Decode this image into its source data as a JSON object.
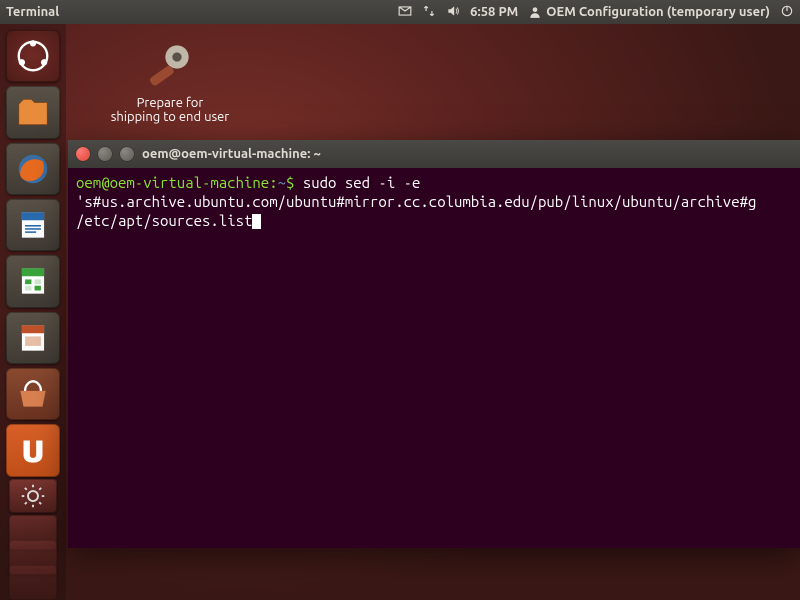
{
  "topbar": {
    "app_title": "Terminal",
    "time": "6:58 PM",
    "user_label": "OEM Configuration (temporary user)"
  },
  "desktop": {
    "icon1": {
      "line1": "Prepare for",
      "line2": "shipping to end user"
    }
  },
  "launcher": {
    "items": [
      {
        "name": "ubuntu-dash"
      },
      {
        "name": "files"
      },
      {
        "name": "firefox"
      },
      {
        "name": "libreoffice-writer"
      },
      {
        "name": "libreoffice-calc"
      },
      {
        "name": "libreoffice-impress"
      },
      {
        "name": "software-center"
      },
      {
        "name": "ubuntu-one"
      },
      {
        "name": "system-settings"
      },
      {
        "name": "workspace-switcher"
      }
    ]
  },
  "terminal": {
    "title": "oem@oem-virtual-machine: ~",
    "prompt_user": "oem@oem-virtual-machine",
    "prompt_path": "~",
    "command": "sudo sed -i -e 's#us.archive.ubuntu.com/ubuntu#mirror.cc.columbia.edu/pub/linux/ubuntu/archive#g /etc/apt/sources.list"
  }
}
